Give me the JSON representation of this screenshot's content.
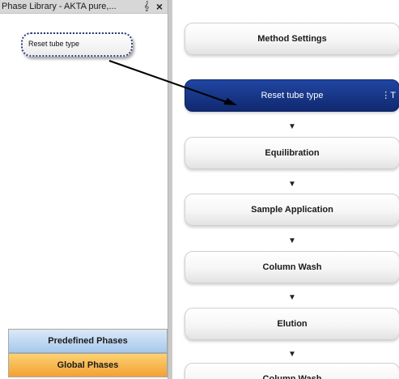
{
  "phase_library": {
    "title": "Phase Library - AKTA pure,...",
    "pin_icon": "pin-icon",
    "close_icon": "close-icon",
    "dragged_item": "Reset tube type",
    "tabs": [
      {
        "label": "Predefined Phases"
      },
      {
        "label": "Global Phases"
      }
    ]
  },
  "method_outline": {
    "phases": [
      {
        "label": "Method Settings"
      },
      {
        "label": "Reset tube type",
        "selected": true,
        "side_label": "⋮T"
      },
      {
        "label": "Equilibration"
      },
      {
        "label": "Sample Application"
      },
      {
        "label": "Column Wash"
      },
      {
        "label": "Elution"
      },
      {
        "label": "Column Wash"
      }
    ],
    "flow_arrow_glyph": "▼"
  },
  "colors": {
    "selected_phase": "#1a3a8f",
    "predefined_tab": "#b9d3f0",
    "global_tab": "#f6b545"
  }
}
